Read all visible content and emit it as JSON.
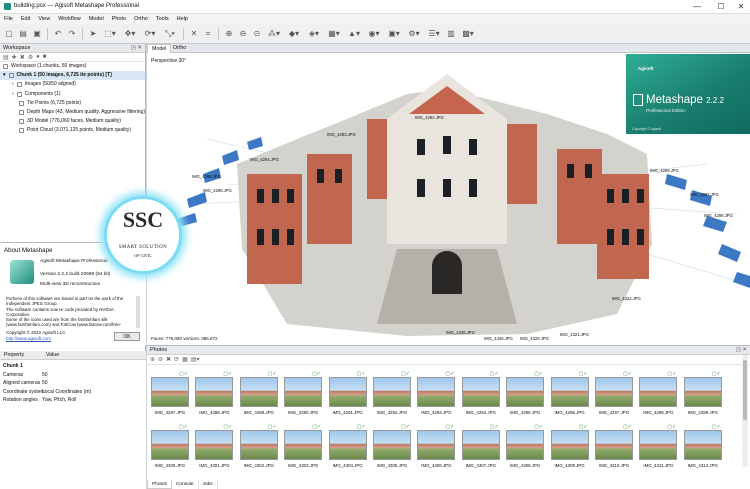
{
  "window": {
    "title": "building.psx — Agisoft Metashape Professional",
    "min": "—",
    "max": "☐",
    "close": "✕"
  },
  "menu": [
    "File",
    "Edit",
    "View",
    "Workflow",
    "Model",
    "Photo",
    "Ortho",
    "Tools",
    "Help"
  ],
  "toolbar_icons": [
    "new-file-icon",
    "open-folder-icon",
    "save-icon",
    "undo-icon",
    "redo-icon",
    "navigation-icon",
    "rect-select-icon",
    "move-icon",
    "rotate-icon",
    "scale-icon",
    "delete-icon",
    "crop-icon",
    "zoom-in-icon",
    "zoom-out-icon",
    "reset-view-icon",
    "point-cloud-icon",
    "model-icon",
    "texture-icon",
    "tiled-icon",
    "dem-icon",
    "camera-icon",
    "photo-icon",
    "settings-icon",
    "grid-icon",
    "chart-icon",
    "image-icon"
  ],
  "workspace": {
    "title": "Workspace",
    "root": "Workspace (1 chunks, 50 images)",
    "chunk": "Chunk 1 (50 images, 6,725 tie points) [T]",
    "items": [
      "Images (50/50 aligned)",
      "Components (1)",
      "Tie Points (6,725 points)",
      "Depth Maps (43, Medium quality, Aggressive filtering)",
      "3D Model (776,060 faces, Medium quality)",
      "Point Cloud (3,071,125 points, Medium quality)"
    ]
  },
  "about": {
    "title": "About Metashape",
    "product": "Agisoft Metashape Professional",
    "version": "Version 2.2.2 build 20689 (64 bit)",
    "desc": "Multi-view 3D reconstruction",
    "license": [
      "Portions of this software are based in part on the work of the",
      "Independent JPEG Group.",
      "The software contains source code provided by NVIDIA",
      "Corporation.",
      "Some of the icons used are from the famfamfam silk",
      "(www.famfamfam.com) and FatCow (www.fatcow.com/free-"
    ],
    "copyright": "Copyright © 2022 Agisoft LLC.",
    "link": "http://www.agisoft.com",
    "ok": "OK"
  },
  "badge": {
    "initials": "SSC",
    "line1": "SMART SOLUTION",
    "line2": "OF CIVIL"
  },
  "properties": {
    "col1": "Property",
    "col2": "Value",
    "section": "Chunk 1",
    "rows": [
      {
        "k": "Cameras",
        "v": "50"
      },
      {
        "k": "Aligned cameras",
        "v": "50"
      },
      {
        "k": "Coordinate system",
        "v": "Local Coordinates (m)"
      },
      {
        "k": "Rotation angles",
        "v": "Yaw, Pitch, Roll"
      }
    ]
  },
  "viewport": {
    "tabs": [
      "Model",
      "Ortho"
    ],
    "perspective": "Perspective 30°",
    "faces": "Faces: 776,060 vertices: 386,672",
    "camera_labels": [
      "IMG_4295.JPG",
      "IMG_4296.JPG",
      "IMG_4294.JPG",
      "IMG_4293.JPG",
      "IMG_4297.JPG",
      "IMG_4298.JPG",
      "IMG_4299.JPG",
      "IMG_4292.JPG",
      "IMG_4322.JPG",
      "IMG_4321.JPG",
      "IMG_4320.JPG",
      "IMG_4336.JPG",
      "IMG_4335.JPG"
    ]
  },
  "splash": {
    "brand": "Agisoft",
    "name": "Metashape",
    "version": "2.2.2",
    "edition": "Professional Edition",
    "footer": "Copyright © Agisoft"
  },
  "photos": {
    "title": "Photos",
    "tabs": [
      "Photos",
      "Console",
      "Jobs"
    ],
    "row1": [
      "IMG_4287.JPG",
      "IMG_4288.JPG",
      "IMG_4289.JPG",
      "IMG_4290.JPG",
      "IMG_4291.JPG",
      "IMG_4292.JPG",
      "IMG_4293.JPG",
      "IMG_4294.JPG",
      "IMG_4295.JPG",
      "IMG_4296.JPG",
      "IMG_4297.JPG",
      "IMG_4298.JPG",
      "IMG_4299.JPG"
    ],
    "row2": [
      "IMG_4300.JPG",
      "IMG_4301.JPG",
      "IMG_4302.JPG",
      "IMG_4303.JPG",
      "IMG_4304.JPG",
      "IMG_4305.JPG",
      "IMG_4306.JPG",
      "IMG_4307.JPG",
      "IMG_4308.JPG",
      "IMG_4309.JPG",
      "IMG_4310.JPG",
      "IMG_4311.JPG",
      "IMG_4312.JPG"
    ]
  }
}
